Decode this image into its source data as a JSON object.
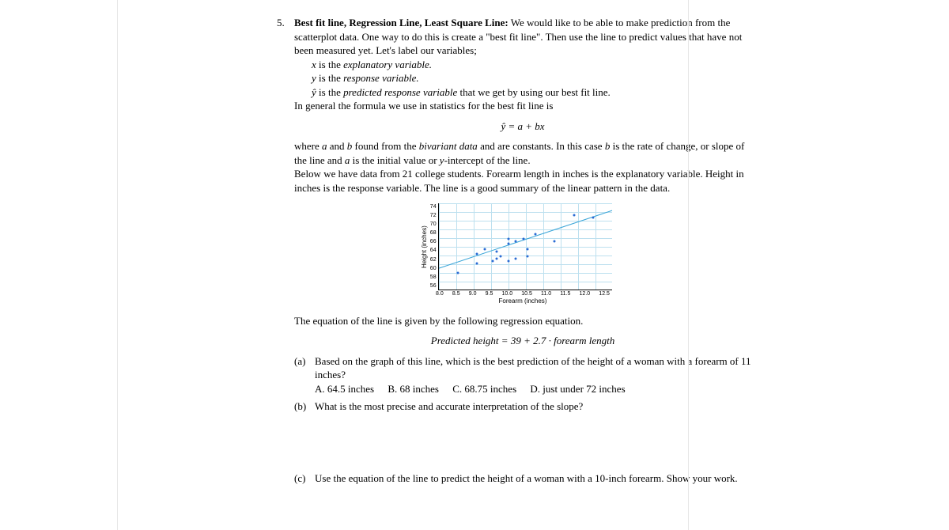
{
  "question_number": "5.",
  "title": "Best fit line, Regression Line, Least Square Line:",
  "intro": " We would like to be able to make prediction from the scatterplot data. One way to do this is create a \"best fit line\". Then use the line to predict values that have not been measured yet. Let's label our variables;",
  "var_x_pre": "x",
  "var_x_mid": " is the ",
  "var_x_em": "explanatory variable.",
  "var_y_pre": "y",
  "var_y_mid": " is the ",
  "var_y_em": "response variable.",
  "var_yhat_pre": "ŷ",
  "var_yhat_mid": " is the ",
  "var_yhat_em": "predicted response variable",
  "var_yhat_post": " that we get by using our best fit line.",
  "formula_intro": "In general the formula we use in statistics for the best fit line is",
  "formula": "ŷ = a + bx",
  "para2a": "where ",
  "para2_a": "a",
  "para2b": " and ",
  "para2_b": "b",
  "para2c": " found from the ",
  "para2_em": "bivariant data",
  "para2d": " and are constants. In this case ",
  "para2_b2": "b",
  "para2e": " is the rate of change, or slope of the line and ",
  "para2_a2": "a",
  "para2f": " is the initial value or ",
  "para2_y": "y",
  "para2g": "-intercept of the line.",
  "para3": "Below we have data from 21 college students. Forearm length in inches is the explanatory variable. Height in inches is the response variable. The line is a good summary of the linear pattern in the data.",
  "eq_intro": "The equation of the line is given by the following regression equation.",
  "eq": "Predicted height = 39 + 2.7 · forearm length",
  "parts": {
    "a": {
      "letter": "(a)",
      "text": "Based on the graph of this line, which is the best prediction of the height of a woman with a forearm of 11 inches?",
      "A": "A. 64.5 inches",
      "B": "B. 68 inches",
      "C": "C. 68.75 inches",
      "D": "D. just under 72 inches"
    },
    "b": {
      "letter": "(b)",
      "text": "What is the most precise and accurate interpretation of the slope?"
    },
    "c": {
      "letter": "(c)",
      "text": "Use the equation of the line to predict the height of a woman with a 10-inch forearm. Show your work."
    }
  },
  "chart_data": {
    "type": "scatter",
    "xlabel": "Forearm (inches)",
    "ylabel": "Height (inches)",
    "xlim": [
      8.0,
      12.5
    ],
    "ylim": [
      56,
      74
    ],
    "xticks": [
      "8.0",
      "8.5",
      "9.0",
      "9.5",
      "10.0",
      "10.5",
      "11.0",
      "11.5",
      "12.0",
      "12.5"
    ],
    "yticks": [
      "74",
      "72",
      "70",
      "68",
      "66",
      "64",
      "62",
      "60",
      "58",
      "56"
    ],
    "points": [
      [
        8.5,
        60
      ],
      [
        9.0,
        62
      ],
      [
        9.0,
        64
      ],
      [
        9.2,
        65
      ],
      [
        9.4,
        62.5
      ],
      [
        9.5,
        63
      ],
      [
        9.5,
        64.5
      ],
      [
        9.6,
        63.5
      ],
      [
        9.8,
        62.5
      ],
      [
        9.8,
        66
      ],
      [
        9.8,
        67
      ],
      [
        10.0,
        66.5
      ],
      [
        10.0,
        63
      ],
      [
        10.2,
        67
      ],
      [
        10.3,
        65
      ],
      [
        10.3,
        63.5
      ],
      [
        10.5,
        68
      ],
      [
        11.0,
        66.5
      ],
      [
        11.5,
        72
      ],
      [
        12.0,
        71.5
      ]
    ],
    "fit_line": {
      "x1": 8.0,
      "y1": 60.5,
      "x2": 12.5,
      "y2": 72.5
    }
  }
}
